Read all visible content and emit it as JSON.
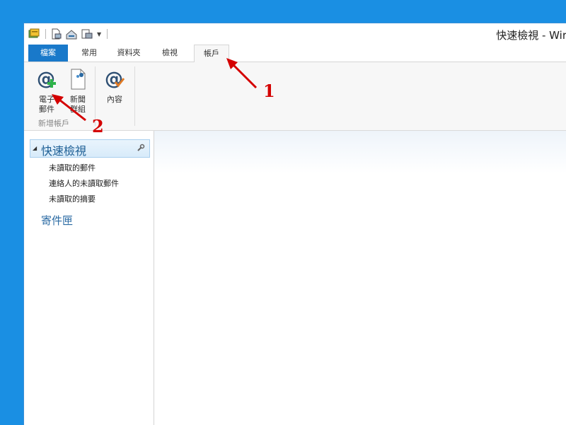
{
  "window": {
    "title": "快速檢視 - Wir"
  },
  "tabs": [
    {
      "label": "檔案"
    },
    {
      "label": "常用"
    },
    {
      "label": "資料夾"
    },
    {
      "label": "檢視"
    },
    {
      "label": "帳戶"
    }
  ],
  "ribbon": {
    "email_label": "電子\n郵件",
    "newsgroup_label": "新聞\n群組",
    "properties_label": "內容",
    "group_label": "新增帳戶"
  },
  "sidebar": {
    "quick_views_title": "快速檢視",
    "items": [
      {
        "label": "未讀取的郵件"
      },
      {
        "label": "連絡人的未讀取郵件"
      },
      {
        "label": "未讀取的摘要"
      }
    ],
    "inbox_label": "寄件匣"
  },
  "annotations": {
    "one": "1",
    "two": "2"
  },
  "colors": {
    "accent": "#1979ca",
    "desktop": "#1a8fe3",
    "arrow": "#d40000"
  }
}
